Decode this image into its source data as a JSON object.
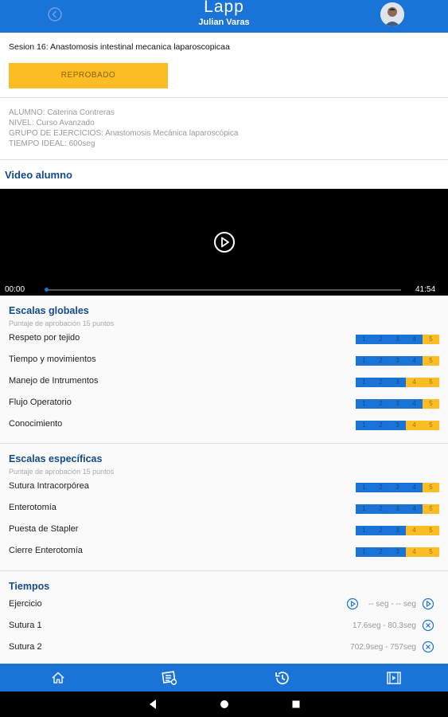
{
  "header": {
    "brand": "Lapp",
    "user": "Julian Varas"
  },
  "session": {
    "title": "Sesion 16: Anastomosis intestinal mecanica laparoscopicaa",
    "status": "REPROBADO"
  },
  "info": {
    "alumno": "ALUMNO: Caterina Contreras",
    "nivel": "NIVEL: Curso Avanzado",
    "grupo": "GRUPO DE EJERCICIOS: Anastomosis Mecánica laparoscópica",
    "tiempo": "TIEMPO IDEAL: 600seg"
  },
  "video": {
    "title": "Video alumno",
    "current_time": "00:00",
    "duration": "41:54",
    "progress_fraction": 0
  },
  "escalas_globales": {
    "title": "Escalas globales",
    "subtitle": "Puntaje de aprobación 15 puntos",
    "items": [
      {
        "label": "Respeto por tejido",
        "score": 4
      },
      {
        "label": "Tiempo y movimientos",
        "score": 4
      },
      {
        "label": "Manejo de Intrumentos",
        "score": 3
      },
      {
        "label": "Flujo Operatorio",
        "score": 4
      },
      {
        "label": "Conocimiento",
        "score": 3
      }
    ]
  },
  "escalas_especificas": {
    "title": "Escalas específicas",
    "subtitle": "Puntaje de aprobación 15 puntos",
    "items": [
      {
        "label": "Sutura Intracorpórea",
        "score": 4
      },
      {
        "label": "Enterotomía",
        "score": 4
      },
      {
        "label": "Puesta de Stapler",
        "score": 3
      },
      {
        "label": "Cierre Enterotomía",
        "score": 3
      }
    ]
  },
  "scale_numbers": [
    "1",
    "2",
    "3",
    "4",
    "5"
  ],
  "tiempos": {
    "title": "Tiempos",
    "items": [
      {
        "label": "Ejercicio",
        "value": "-- seg - -- seg"
      },
      {
        "label": "Sutura 1",
        "value": "17.6seg - 80.3seg"
      },
      {
        "label": "Sutura 2",
        "value": "702.9seg - 757seg"
      }
    ]
  },
  "colors": {
    "primary": "#1a73d6",
    "accent": "#fbbd23",
    "heading": "#124a8a"
  },
  "icons": {
    "back": "back-icon",
    "play": "play-icon",
    "nav": [
      "home-icon",
      "list-icon",
      "history-icon",
      "video-icon"
    ],
    "system": [
      "back-triangle-icon",
      "home-circle-icon",
      "recents-square-icon"
    ]
  }
}
